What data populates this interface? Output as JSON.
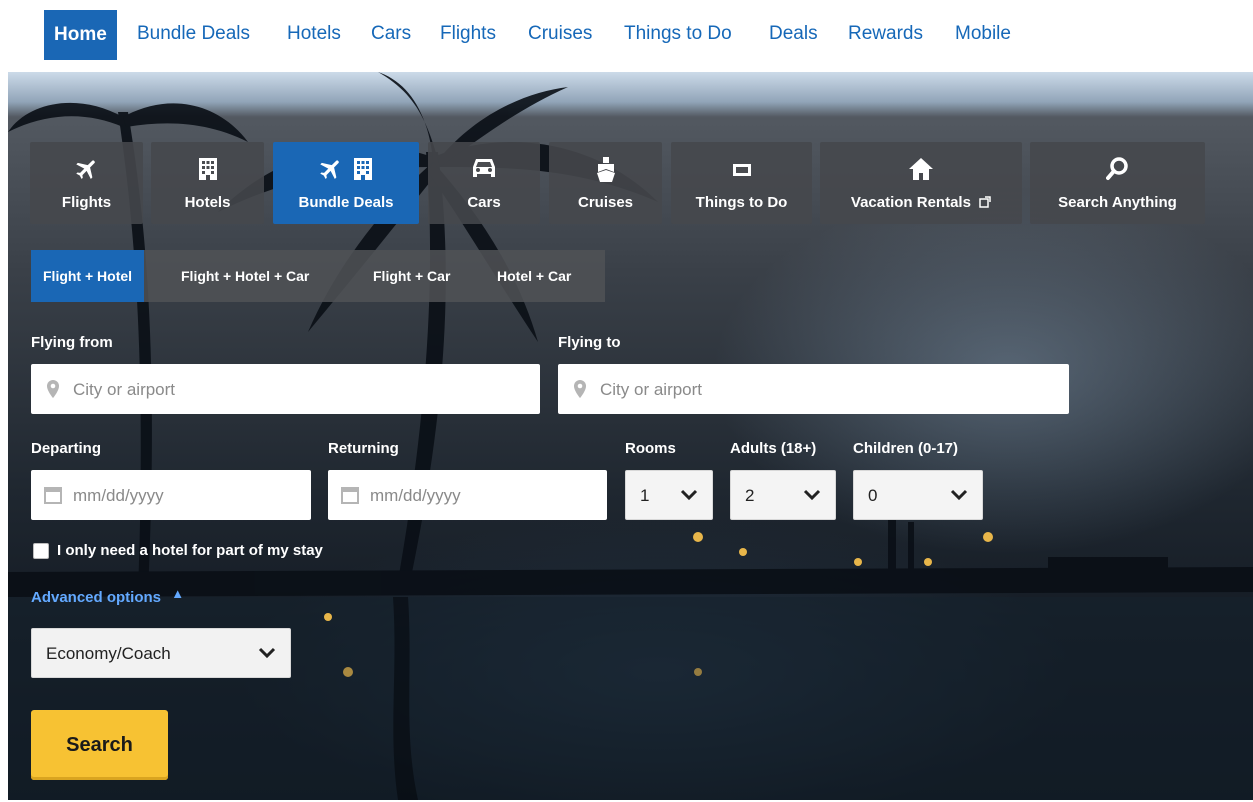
{
  "topnav": {
    "items": [
      "Home",
      "Bundle Deals",
      "Hotels",
      "Cars",
      "Flights",
      "Cruises",
      "Things to Do",
      "Deals",
      "Rewards",
      "Mobile"
    ]
  },
  "products": {
    "tabs": [
      "Flights",
      "Hotels",
      "Bundle Deals",
      "Cars",
      "Cruises",
      "Things to Do",
      "Vacation Rentals",
      "Search Anything"
    ]
  },
  "subtabs": [
    "Flight + Hotel",
    "Flight + Hotel + Car",
    "Flight + Car",
    "Hotel + Car"
  ],
  "form": {
    "flying_from_label": "Flying from",
    "flying_from_placeholder": "City or airport",
    "flying_to_label": "Flying to",
    "flying_to_placeholder": "City or airport",
    "departing_label": "Departing",
    "departing_placeholder": "mm/dd/yyyy",
    "returning_label": "Returning",
    "returning_placeholder": "mm/dd/yyyy",
    "rooms_label": "Rooms",
    "rooms_value": "1",
    "adults_label": "Adults (18+)",
    "adults_value": "2",
    "children_label": "Children (0-17)",
    "children_value": "0",
    "partial_stay_label": "I only need a hotel for part of my stay",
    "advanced_options_label": "Advanced options",
    "cabin_class_value": "Economy/Coach",
    "search_label": "Search"
  },
  "colors": {
    "brand_blue": "#1a67b5",
    "link_blue": "#1668b8",
    "search_yellow": "#f7c233"
  },
  "icons": [
    "plane-icon",
    "building-icon",
    "car-icon",
    "ship-icon",
    "ticket-icon",
    "house-icon",
    "magnifier-icon",
    "external-link-icon",
    "map-pin-icon",
    "calendar-icon",
    "chevron-down-icon",
    "chevron-up-icon"
  ]
}
